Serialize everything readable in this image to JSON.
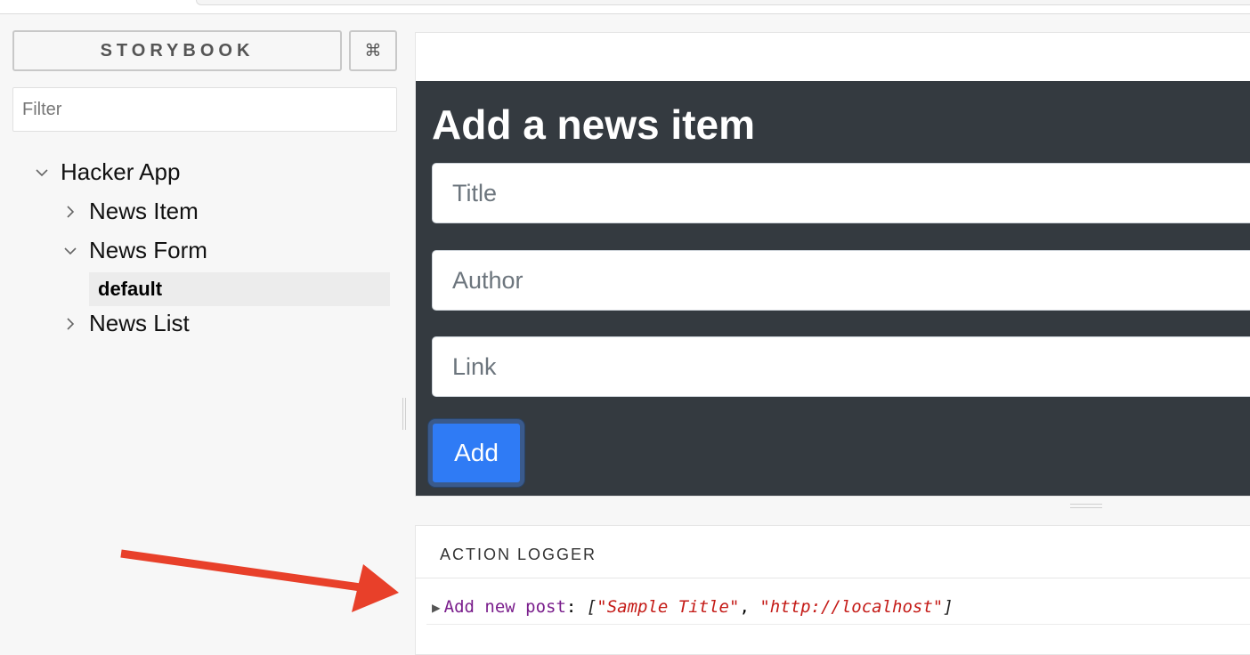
{
  "sidebar": {
    "brand_label": "STORYBOOK",
    "shortcut_label": "⌘",
    "filter_placeholder": "Filter",
    "tree": {
      "root": "Hacker App",
      "children": [
        "News Item",
        "News Form",
        "News List"
      ],
      "selected_story": "default"
    }
  },
  "preview": {
    "title": "Add a news item",
    "fields": {
      "title_placeholder": "Title",
      "author_placeholder": "Author",
      "link_placeholder": "Link"
    },
    "add_button_label": "Add"
  },
  "addons_panel": {
    "tab_label": "ACTION LOGGER",
    "log_entry": {
      "action_name": "Add new post",
      "colon": ":",
      "open_bracket": "[",
      "arg1": "\"Sample Title\"",
      "comma": ",",
      "arg2": "\"http://localhost\"",
      "close_bracket": "]"
    }
  },
  "colors": {
    "preview_dark_bg": "#343a40",
    "add_button_bg": "#2f7bf5",
    "annotation_arrow": "#e8402a"
  },
  "icons": {
    "expand_collapsed": "chevron-right-icon",
    "expand_open": "chevron-down-icon",
    "log_toggle": "triangle-right-icon"
  }
}
